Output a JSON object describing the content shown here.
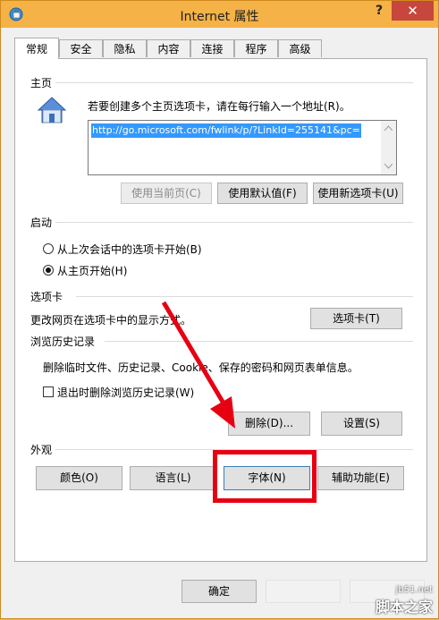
{
  "window": {
    "title": "Internet 属性",
    "help_glyph": "?",
    "close_glyph": "✕"
  },
  "tabs": [
    "常规",
    "安全",
    "隐私",
    "内容",
    "连接",
    "程序",
    "高级"
  ],
  "home": {
    "section": "主页",
    "instruction": "若要创建多个主页选项卡，请在每行输入一个地址(R)。",
    "url": "http://go.microsoft.com/fwlink/p/?LinkId=255141&pc=",
    "btn_current": "使用当前页(C)",
    "btn_default": "使用默认值(F)",
    "btn_newtab": "使用新选项卡(U)"
  },
  "startup": {
    "section": "启动",
    "opt_last": "从上次会话中的选项卡开始(B)",
    "opt_home": "从主页开始(H)"
  },
  "tabs_section": {
    "section": "选项卡",
    "desc": "更改网页在选项卡中的显示方式。",
    "btn": "选项卡(T)"
  },
  "history": {
    "section": "浏览历史记录",
    "desc": "删除临时文件、历史记录、Cookie、保存的密码和网页表单信息。",
    "checkbox": "退出时删除浏览历史记录(W)",
    "btn_delete": "删除(D)...",
    "btn_settings": "设置(S)"
  },
  "appearance": {
    "section": "外观",
    "btn_colors": "颜色(O)",
    "btn_languages": "语言(L)",
    "btn_fonts": "字体(N)",
    "btn_accessibility": "辅助功能(E)"
  },
  "footer": {
    "ok": "确定"
  },
  "watermark": {
    "site": "jb51.net",
    "brand": "脚本之家"
  },
  "colors": {
    "titlebar": "#f4b247",
    "close": "#c7463d",
    "highlight": "#e60012",
    "selection": "#3399ff"
  }
}
